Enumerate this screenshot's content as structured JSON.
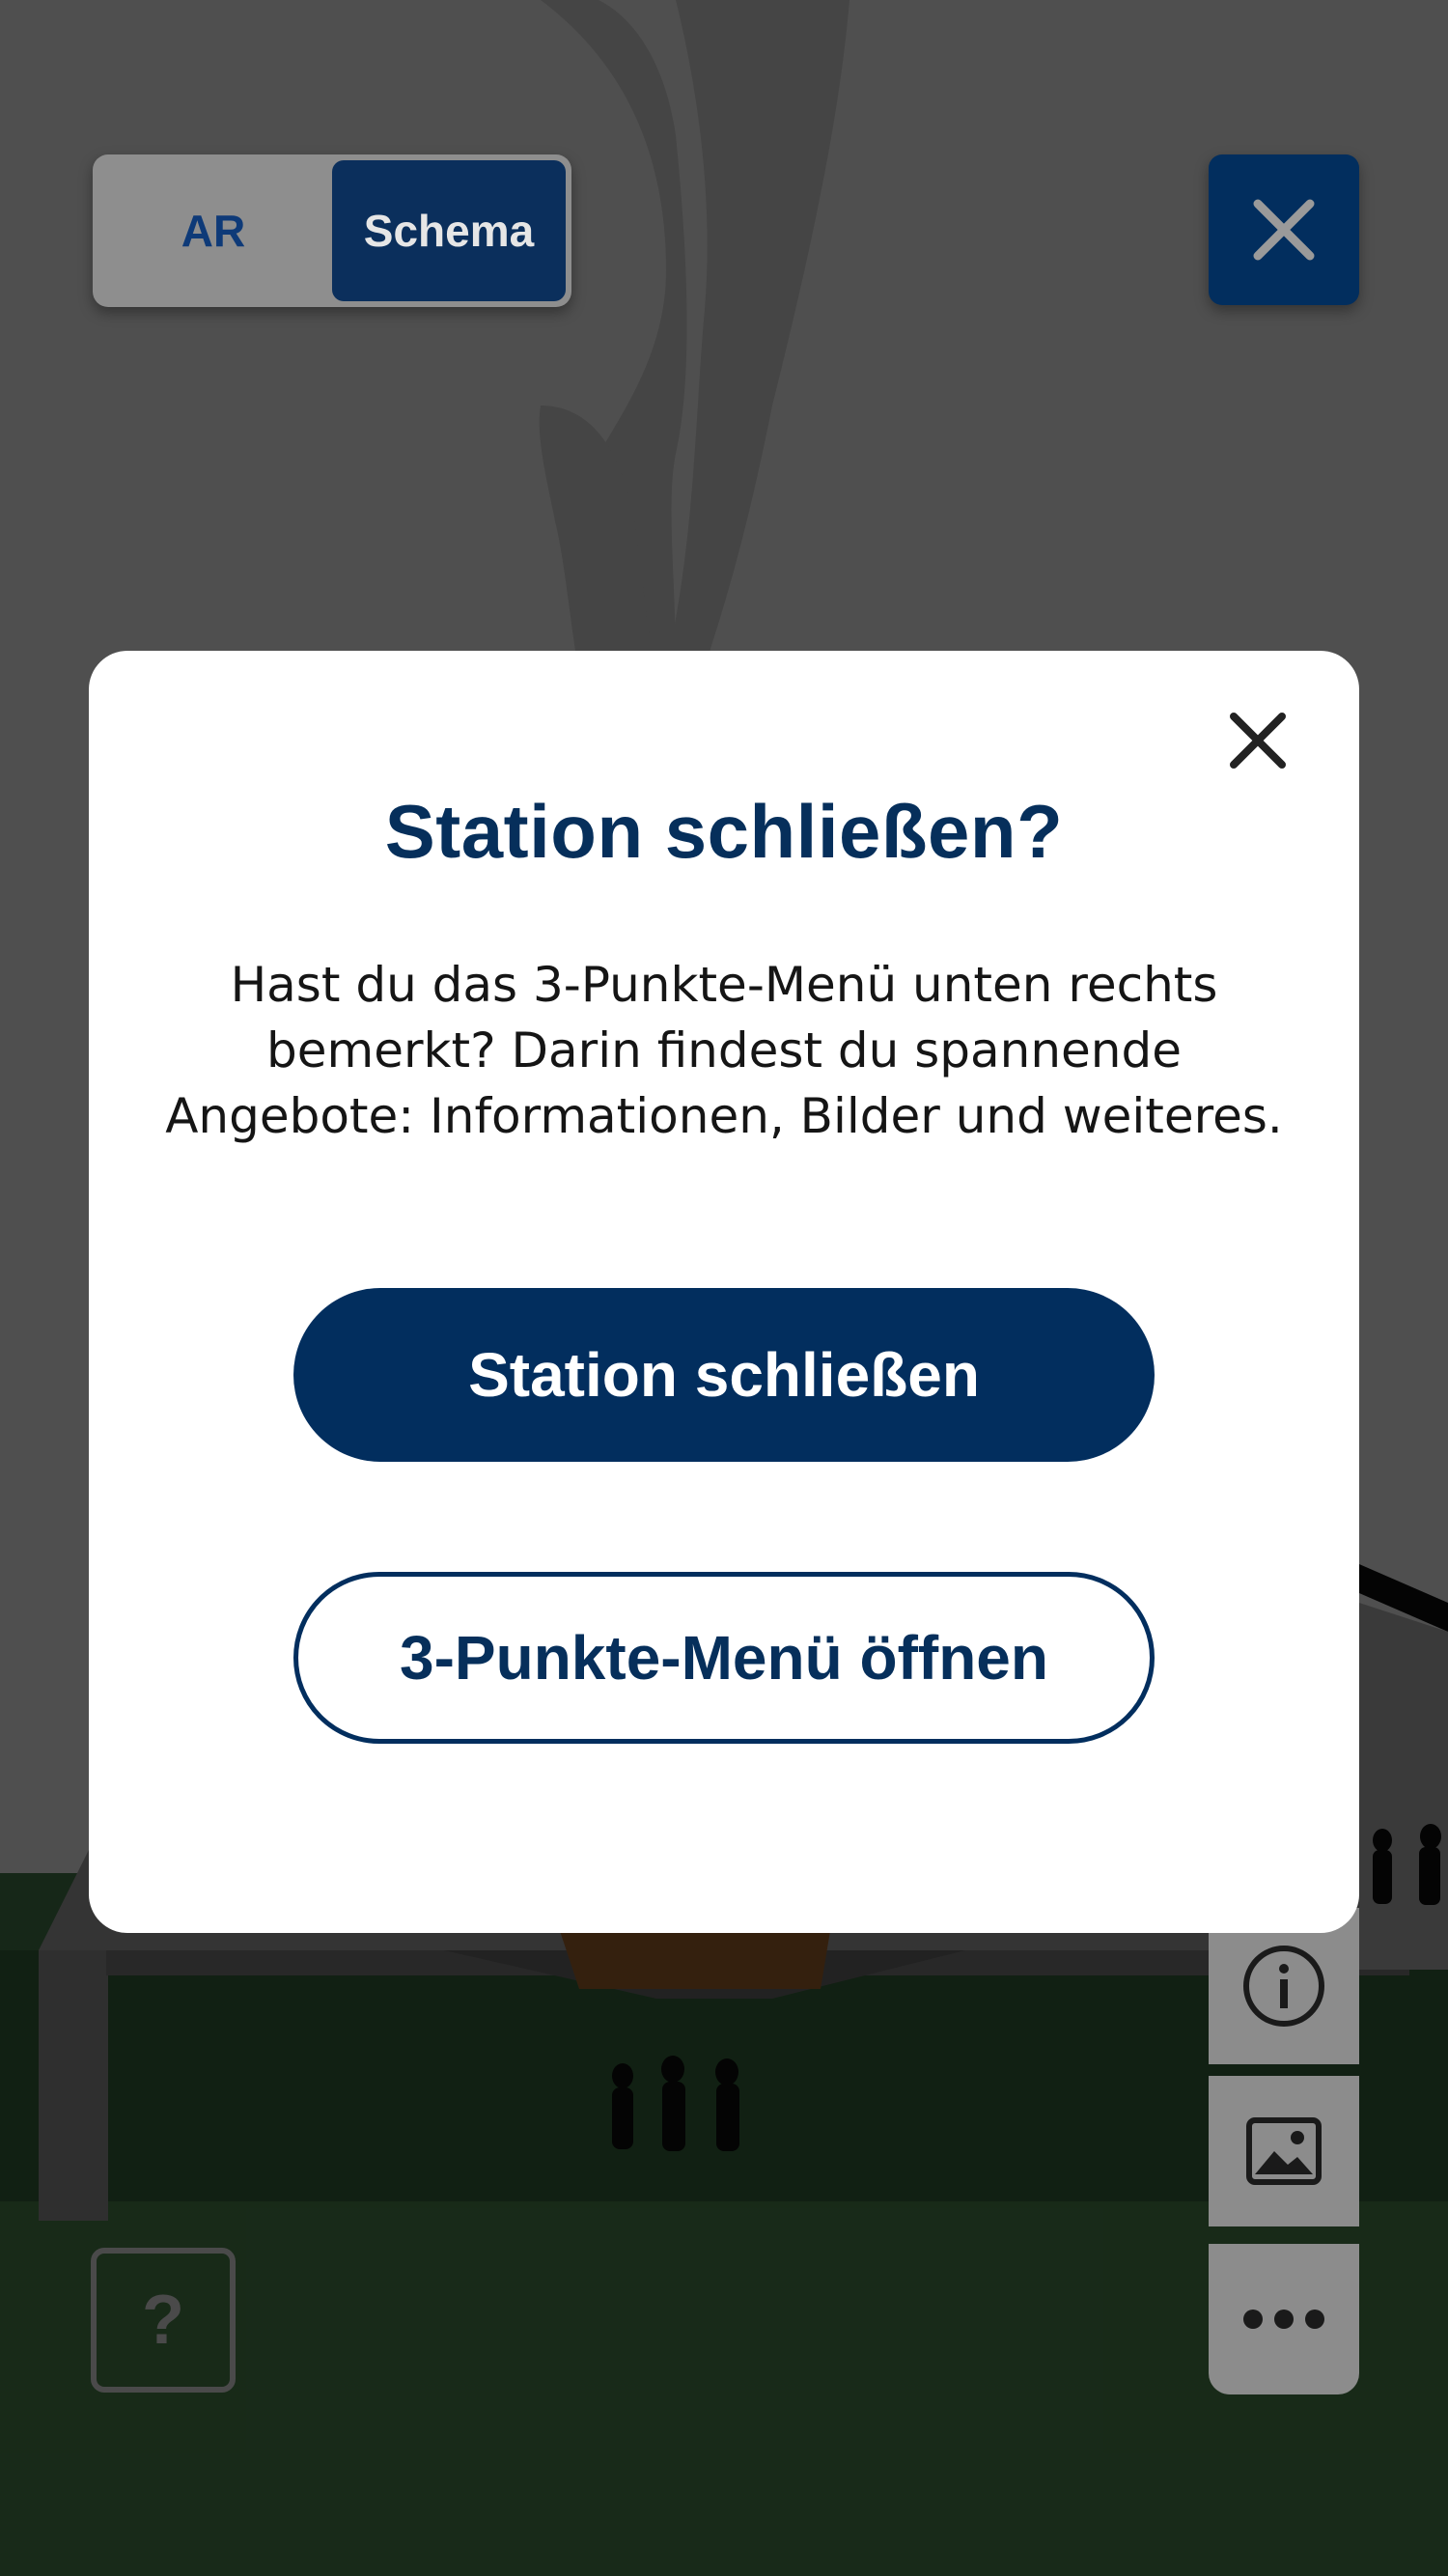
{
  "topbar": {
    "mode_toggle": {
      "ar_label": "AR",
      "schema_label": "Schema",
      "selected": "Schema"
    },
    "close_icon": "close-icon"
  },
  "sidebar": {
    "items": [
      {
        "icon": "info-icon"
      },
      {
        "icon": "image-icon"
      },
      {
        "icon": "more-dots-icon"
      }
    ]
  },
  "help": {
    "label": "?"
  },
  "dialog": {
    "title": "Station schließen?",
    "body_lines": [
      "Hast du das 3-Punkte-Menü unten rechts",
      "bemerkt? Darin findest du spannende",
      "Angebote: Informationen, Bilder und weiteres."
    ],
    "primary_label": "Station schließen",
    "secondary_label": "3-Punkte-Menü öffnen",
    "close_icon": "close-icon"
  },
  "colors": {
    "brand_navy": "#022e5e",
    "title_navy": "#062f5b",
    "dialog_bg": "#ffffff"
  }
}
